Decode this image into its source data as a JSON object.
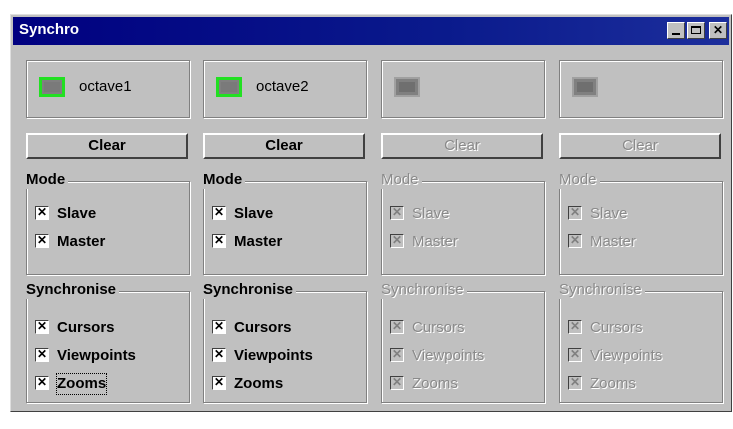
{
  "window": {
    "title": "Synchro"
  },
  "clear_label": "Clear",
  "mode_title": "Mode",
  "sync_title": "Synchronise",
  "mode_items": [
    "Slave",
    "Master"
  ],
  "sync_items": [
    "Cursors",
    "Viewpoints",
    "Zooms"
  ],
  "check_mark": "✕",
  "columns": [
    {
      "track": "octave1",
      "enabled": true
    },
    {
      "track": "octave2",
      "enabled": true
    },
    {
      "track": "",
      "enabled": false
    },
    {
      "track": "",
      "enabled": false
    }
  ],
  "colors": {
    "title_bar": "#000080",
    "active_swatch_border": "#22e022",
    "window_bg": "#c0c0c0"
  }
}
